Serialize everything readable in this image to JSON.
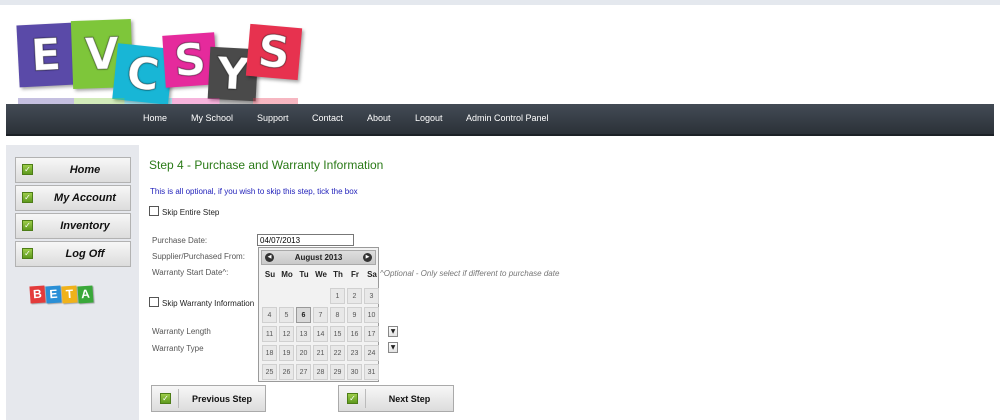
{
  "logo": {
    "letters": [
      "E",
      "V",
      "C",
      "S",
      "Y",
      "S"
    ],
    "colors": [
      "#5a4aa8",
      "#7ec63a",
      "#18b6d6",
      "#e52a9c",
      "#4a4a4a",
      "#e7324f"
    ]
  },
  "nav": {
    "items": [
      "Home",
      "My School",
      "Support",
      "Contact",
      "About",
      "Logout",
      "Admin Control Panel"
    ]
  },
  "sidebar": {
    "items": [
      "Home",
      "My Account",
      "Inventory",
      "Log Off"
    ],
    "beta_letters": [
      "B",
      "E",
      "T",
      "A"
    ],
    "beta_colors": [
      "#e33b3b",
      "#2a8fd6",
      "#f0b21b",
      "#3aa83a"
    ]
  },
  "main": {
    "title": "Step 4 - Purchase and Warranty Information",
    "intro": "This is all optional, if you wish to skip this step, tick the box",
    "skip_entire": "Skip Entire Step",
    "purchase_date_label": "Purchase Date:",
    "purchase_date_value": "04/07/2013",
    "supplier_label": "Supplier/Purchased From:",
    "warranty_start_label": "Warranty Start Date^:",
    "warranty_note": "^Optional - Only select if different to purchase date",
    "skip_warranty": "Skip Warranty Information",
    "warranty_length_label": "Warranty Length",
    "warranty_type_label": "Warranty Type"
  },
  "calendar": {
    "month_label": "August 2013",
    "weekdays": [
      "Su",
      "Mo",
      "Tu",
      "We",
      "Th",
      "Fr",
      "Sa"
    ],
    "first_weekday_index": 4,
    "days_in_month": 31,
    "selected_day": 6
  },
  "buttons": {
    "previous": "Previous Step",
    "next": "Next Step"
  },
  "colors": {
    "title_green": "#2a7a17",
    "intro_blue": "#2222bb",
    "nav_bg": "#353c44"
  }
}
